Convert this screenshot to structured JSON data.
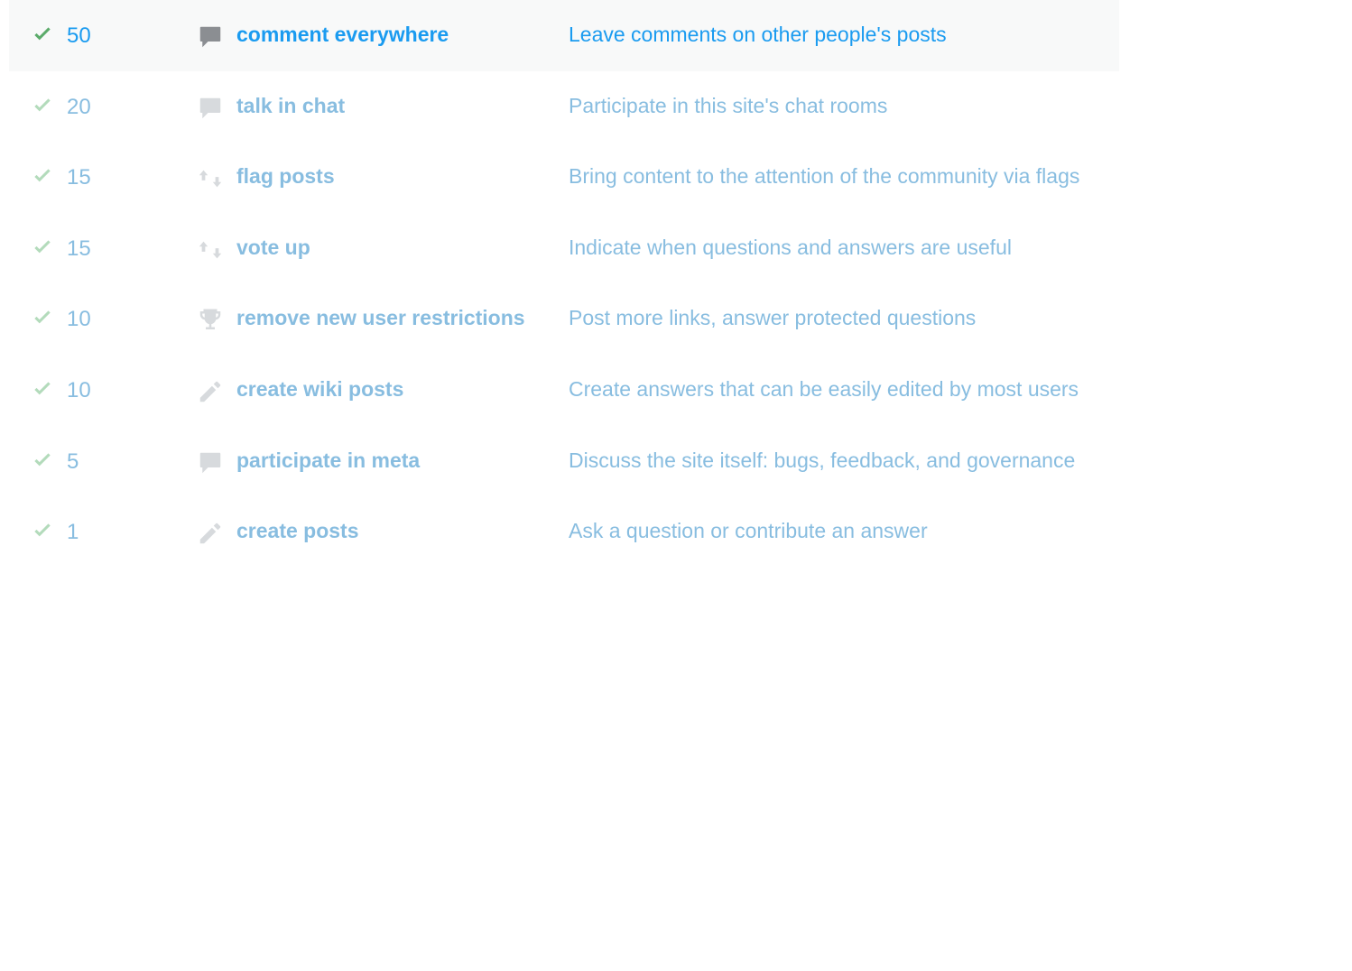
{
  "privileges": [
    {
      "rep": "50",
      "name": "comment everywhere",
      "desc": "Leave comments on other people's posts",
      "icon": "comment",
      "highlighted": true,
      "checkStyle": "dark",
      "iconStyle": "dark"
    },
    {
      "rep": "20",
      "name": "talk in chat",
      "desc": "Participate in this site's chat rooms",
      "icon": "comment",
      "highlighted": false,
      "checkStyle": "light",
      "iconStyle": "light"
    },
    {
      "rep": "15",
      "name": "flag posts",
      "desc": "Bring content to the attention of the community via flags",
      "icon": "votes",
      "highlighted": false,
      "checkStyle": "light",
      "iconStyle": "light"
    },
    {
      "rep": "15",
      "name": "vote up",
      "desc": "Indicate when questions and answers are useful",
      "icon": "votes",
      "highlighted": false,
      "checkStyle": "light",
      "iconStyle": "light"
    },
    {
      "rep": "10",
      "name": "remove new user restrictions",
      "desc": "Post more links, answer protected questions",
      "icon": "trophy",
      "highlighted": false,
      "checkStyle": "light",
      "iconStyle": "light"
    },
    {
      "rep": "10",
      "name": "create wiki posts",
      "desc": "Create answers that can be easily edited by most users",
      "icon": "pencil",
      "highlighted": false,
      "checkStyle": "light",
      "iconStyle": "light"
    },
    {
      "rep": "5",
      "name": "participate in meta",
      "desc": "Discuss the site itself: bugs, feedback, and governance",
      "icon": "comment",
      "highlighted": false,
      "checkStyle": "light",
      "iconStyle": "light"
    },
    {
      "rep": "1",
      "name": "create posts",
      "desc": "Ask a question or contribute an answer",
      "icon": "pencil",
      "highlighted": false,
      "checkStyle": "light",
      "iconStyle": "light"
    }
  ]
}
